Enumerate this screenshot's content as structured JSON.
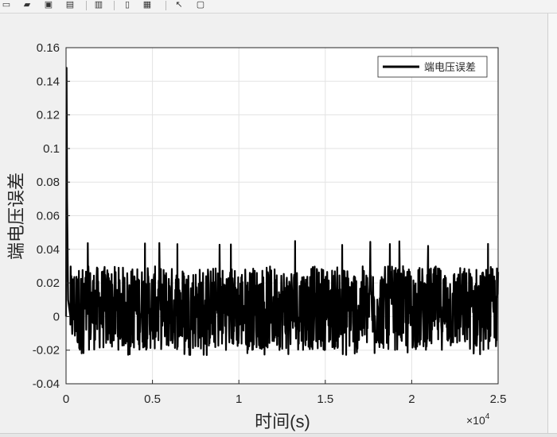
{
  "toolbar": {
    "buttons": [
      {
        "name": "new-figure-icon",
        "glyph": "▭"
      },
      {
        "name": "open-file-icon",
        "glyph": "▰"
      },
      {
        "name": "save-icon",
        "glyph": "▣"
      },
      {
        "name": "print-preview-icon",
        "glyph": "▤"
      },
      {
        "name": "print-icon",
        "glyph": "▥"
      },
      {
        "name": "link-icon",
        "glyph": "▯"
      },
      {
        "name": "insert-legend-icon",
        "glyph": "▦"
      },
      {
        "name": "pointer-icon",
        "glyph": "↖"
      },
      {
        "name": "property-inspector-icon",
        "glyph": "▢"
      }
    ]
  },
  "chart_data": {
    "type": "line",
    "xlabel": "时间(s)",
    "ylabel": "端电压误差",
    "x_exponent_label": "×10",
    "x_exponent_power": "4",
    "xlim": [
      0,
      25000
    ],
    "ylim": [
      -0.04,
      0.16
    ],
    "x_ticks": [
      "0",
      "0.5",
      "1",
      "1.5",
      "2",
      "2.5"
    ],
    "y_ticks": [
      "-0.04",
      "-0.02",
      "0",
      "0.02",
      "0.04",
      "0.06",
      "0.08",
      "0.1",
      "0.12",
      "0.14",
      "0.16"
    ],
    "x_tick_values": [
      0,
      5000,
      10000,
      15000,
      20000,
      25000
    ],
    "y_tick_values": [
      -0.04,
      -0.02,
      0,
      0.02,
      0.04,
      0.06,
      0.08,
      0.1,
      0.12,
      0.14,
      0.16
    ],
    "grid": true,
    "legend_position": "top-right",
    "colors": {
      "series": "#000000",
      "grid": "#e3e3e3",
      "axes": "#262626",
      "plot_bg": "#ffffff"
    },
    "series": [
      {
        "name": "端电压误差",
        "initial_spike": {
          "x": [
            0,
            30,
            60,
            120,
            250
          ],
          "y": [
            0.0,
            0.148,
            0.07,
            0.01,
            0.0
          ]
        },
        "noise_band": {
          "x_start": 250,
          "x_end": 25000,
          "typical_min": -0.02,
          "typical_max": 0.03,
          "peak_min": -0.023,
          "peak_max": 0.045
        }
      }
    ]
  }
}
